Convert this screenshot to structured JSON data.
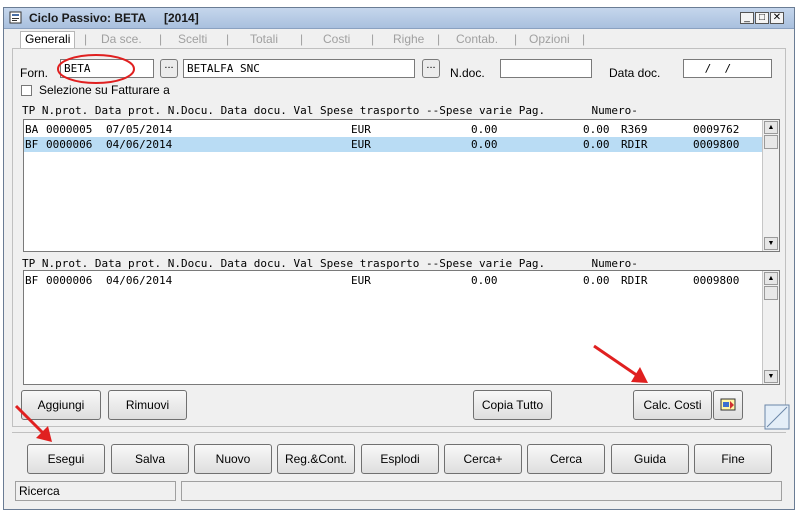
{
  "window": {
    "title": "Ciclo Passivo: BETA",
    "year": "[2014]",
    "minimize": "_",
    "restore": "□",
    "close": "✕"
  },
  "tabs": [
    "Generali",
    "Da sce.",
    "Scelti",
    "Totali",
    "Costi",
    "Righe",
    "Contab.",
    "Opzioni"
  ],
  "form": {
    "forn_label": "Forn.",
    "forn_code": "BETA",
    "forn_lookup": "...",
    "forn_name": "BETALFA SNC",
    "name_lookup": "...",
    "ndoc_label": "N.doc.",
    "ndoc_value": "",
    "datadoc_label": "Data doc.",
    "datadoc_value": " /  /",
    "selezione_label": "Selezione su Fatturare a"
  },
  "table_header": "TP N.prot. Data prot. N.Docu. Data docu. Val Spese trasporto --Spese varie Pag.       Numero-",
  "top_list": {
    "rows": [
      {
        "tp": "BA",
        "prot": "0000005",
        "data": "07/05/2014",
        "val": "EUR",
        "trasporto": "0.00",
        "varie": "0.00",
        "pag": "R369",
        "numero": "0009762"
      },
      {
        "tp": "BF",
        "prot": "0000006",
        "data": "04/06/2014",
        "val": "EUR",
        "trasporto": "0.00",
        "varie": "0.00",
        "pag": "RDIR",
        "numero": "0009800"
      }
    ]
  },
  "bottom_list": {
    "rows": [
      {
        "tp": "BF",
        "prot": "0000006",
        "data": "04/06/2014",
        "val": "EUR",
        "trasporto": "0.00",
        "varie": "0.00",
        "pag": "RDIR",
        "numero": "0009800"
      }
    ]
  },
  "panel_buttons": {
    "aggiungi": "Aggiungi",
    "rimuovi": "Rimuovi",
    "copia_tutto": "Copia Tutto",
    "calc_costi": "Calc. Costi"
  },
  "bottom_buttons": [
    "Esegui",
    "Salva",
    "Nuovo",
    "Reg.&Cont.",
    "Esplodi",
    "Cerca+",
    "Cerca",
    "Guida",
    "Fine"
  ],
  "status": {
    "left": "Ricerca",
    "right": ""
  },
  "colors": {
    "selection": "#b9dcf4",
    "annotation_red": "#e02020"
  },
  "icons": [
    "app-icon",
    "export-icon",
    "arrow-annotation"
  ]
}
